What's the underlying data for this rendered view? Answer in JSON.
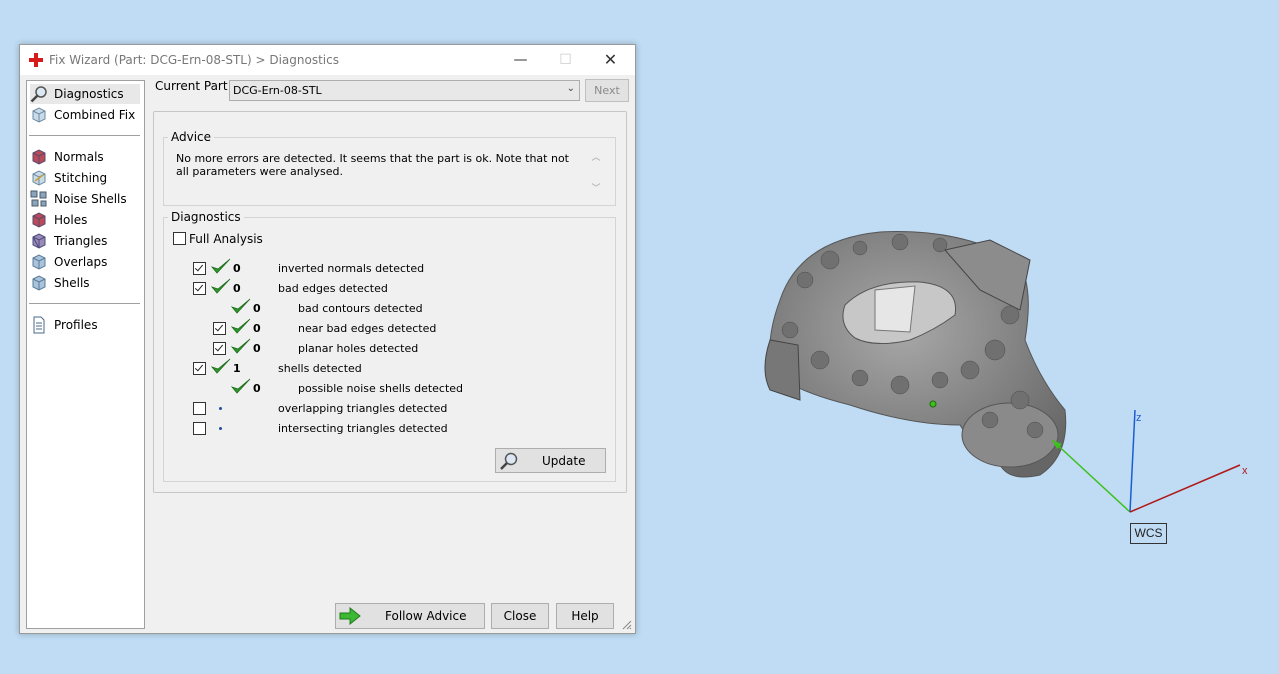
{
  "window": {
    "title": "Fix Wizard (Part: DCG-Ern-08-STL) > Diagnostics",
    "min_glyph": "—",
    "max_glyph": "☐",
    "close_glyph": "✕"
  },
  "nav": {
    "items": [
      {
        "label": "Diagnostics",
        "icon": "magnifier-icon",
        "selected": true
      },
      {
        "label": "Combined Fix",
        "icon": "cube-icon"
      },
      {
        "label": "Normals",
        "icon": "normals-cube-icon"
      },
      {
        "label": "Stitching",
        "icon": "stitching-cube-icon"
      },
      {
        "label": "Noise Shells",
        "icon": "noise-shells-icon"
      },
      {
        "label": "Holes",
        "icon": "holes-cube-icon"
      },
      {
        "label": "Triangles",
        "icon": "triangles-cube-icon"
      },
      {
        "label": "Overlaps",
        "icon": "overlaps-cube-icon"
      },
      {
        "label": "Shells",
        "icon": "shells-cube-icon"
      },
      {
        "label": "Profiles",
        "icon": "document-icon"
      }
    ]
  },
  "current_part": {
    "label": "Current Part:",
    "value": "DCG-Ern-08-STL",
    "next_label": "Next"
  },
  "advice": {
    "legend": "Advice",
    "text": "No more errors are detected. It seems that the part is ok. Note that not all parameters were analysed."
  },
  "diagnostics": {
    "legend": "Diagnostics",
    "full_analysis_label": "Full Analysis",
    "full_analysis_checked": false,
    "rows": [
      {
        "checkbox": true,
        "checked": true,
        "ok": true,
        "count": "0",
        "label": "inverted normals detected",
        "indent": 0
      },
      {
        "checkbox": true,
        "checked": true,
        "ok": true,
        "count": "0",
        "label": "bad edges detected",
        "indent": 0
      },
      {
        "checkbox": false,
        "checked": false,
        "ok": true,
        "count": "0",
        "label": "bad contours detected",
        "indent": 1
      },
      {
        "checkbox": true,
        "checked": true,
        "ok": true,
        "count": "0",
        "label": "near bad edges detected",
        "indent": 1
      },
      {
        "checkbox": true,
        "checked": true,
        "ok": true,
        "count": "0",
        "label": "planar holes detected",
        "indent": 1
      },
      {
        "checkbox": true,
        "checked": true,
        "ok": true,
        "count": "1",
        "label": "shells detected",
        "indent": 0
      },
      {
        "checkbox": false,
        "checked": false,
        "ok": true,
        "count": "0",
        "label": "possible noise shells detected",
        "indent": 1
      },
      {
        "checkbox": true,
        "checked": false,
        "ok": false,
        "count": "",
        "label": "overlapping triangles detected",
        "indent": 0
      },
      {
        "checkbox": true,
        "checked": false,
        "ok": false,
        "count": "",
        "label": "intersecting triangles detected",
        "indent": 0
      }
    ],
    "update_label": "Update"
  },
  "footer": {
    "follow_label": "Follow Advice",
    "close_label": "Close",
    "help_label": "Help"
  },
  "viewport": {
    "axis_x": "x",
    "axis_z": "z",
    "wcs": "WCS",
    "colors": {
      "x_axis": "#b01818",
      "y_axis": "#3cc01c",
      "z_axis": "#1c5ed0",
      "background": "#bfdcf4",
      "model": "#8c8c8c"
    }
  }
}
